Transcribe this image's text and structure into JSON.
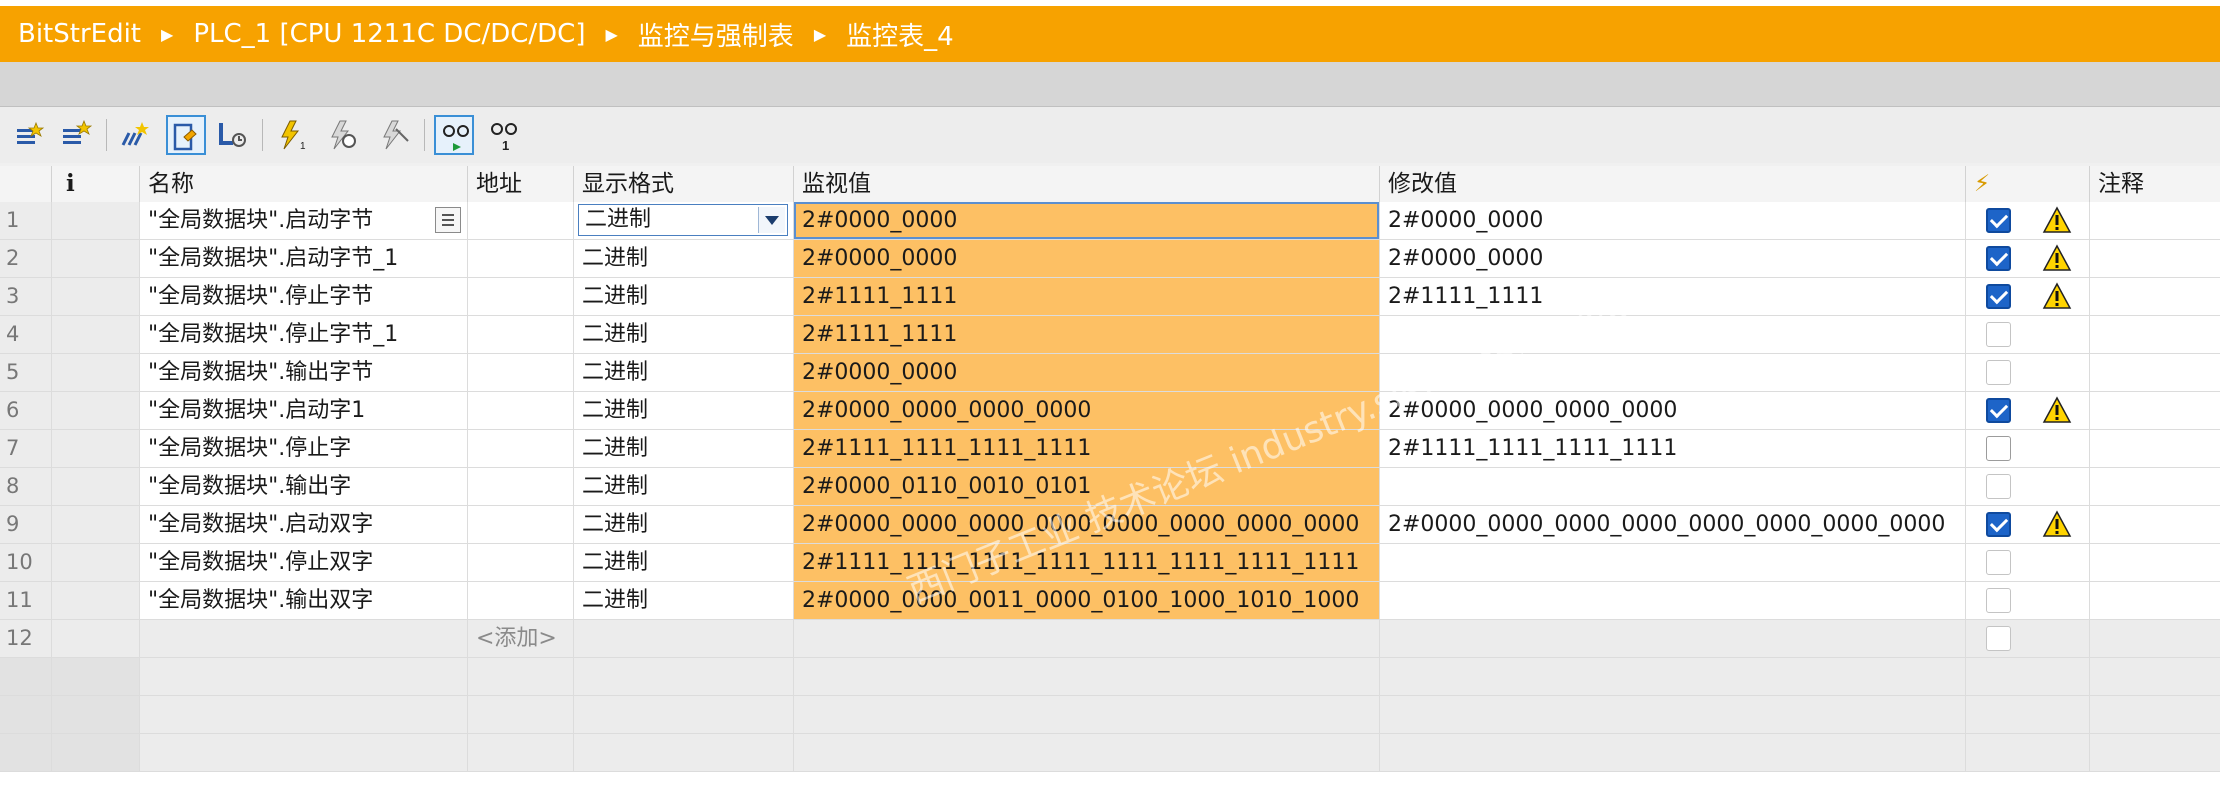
{
  "breadcrumb": {
    "items": [
      "BitStrEdit",
      "PLC_1 [CPU 1211C DC/DC/DC]",
      "监控与强制表",
      "监控表_4"
    ]
  },
  "colors": {
    "title_bar": "#f7a200",
    "value_fill": "#fdc064",
    "checkbox_on": "#1d64c8"
  },
  "toolbar": {
    "icons": [
      "insert-row-icon",
      "add-row-icon",
      "update-snapshot-icon",
      "monitor-all-icon",
      "monitor-now-icon",
      "force-icon",
      "force-now-icon",
      "stop-force-icon",
      "monitor-toggle-icon",
      "monitor-once-icon"
    ]
  },
  "table": {
    "columns": {
      "info": "i",
      "name": "名称",
      "address": "地址",
      "format": "显示格式",
      "monitor": "监视值",
      "modify": "修改值",
      "force": "⚡",
      "comment": "注释"
    },
    "add_label": "<添加>",
    "add_row_num": "12",
    "rows": [
      {
        "num": "1",
        "name": "\"全局数据块\".启动字节",
        "format": "二进制",
        "monitor": "2#0000_0000",
        "modify": "2#0000_0000",
        "checked": true,
        "warn": true
      },
      {
        "num": "2",
        "name": "\"全局数据块\".启动字节_1",
        "format": "二进制",
        "monitor": "2#0000_0000",
        "modify": "2#0000_0000",
        "checked": true,
        "warn": true
      },
      {
        "num": "3",
        "name": "\"全局数据块\".停止字节",
        "format": "二进制",
        "monitor": "2#1111_1111",
        "modify": "2#1111_1111",
        "checked": true,
        "warn": true
      },
      {
        "num": "4",
        "name": "\"全局数据块\".停止字节_1",
        "format": "二进制",
        "monitor": "2#1111_1111",
        "modify": "",
        "checked": false,
        "warn": false
      },
      {
        "num": "5",
        "name": "\"全局数据块\".输出字节",
        "format": "二进制",
        "monitor": "2#0000_0000",
        "modify": "",
        "checked": false,
        "warn": false
      },
      {
        "num": "6",
        "name": "\"全局数据块\".启动字1",
        "format": "二进制",
        "monitor": "2#0000_0000_0000_0000",
        "modify": "2#0000_0000_0000_0000",
        "checked": true,
        "warn": true
      },
      {
        "num": "7",
        "name": "\"全局数据块\".停止字",
        "format": "二进制",
        "monitor": "2#1111_1111_1111_1111",
        "modify": "2#1111_1111_1111_1111",
        "checked": false,
        "warn": false
      },
      {
        "num": "8",
        "name": "\"全局数据块\".输出字",
        "format": "二进制",
        "monitor": "2#0000_0110_0010_0101",
        "modify": "",
        "checked": false,
        "warn": false
      },
      {
        "num": "9",
        "name": "\"全局数据块\".启动双字",
        "format": "二进制",
        "monitor": "2#0000_0000_0000_0000_0000_0000_0000_0000",
        "modify": "2#0000_0000_0000_0000_0000_0000_0000_0000",
        "checked": true,
        "warn": true
      },
      {
        "num": "10",
        "name": "\"全局数据块\".停止双字",
        "format": "二进制",
        "monitor": "2#1111_1111_1111_1111_1111_1111_1111_1111",
        "modify": "",
        "checked": false,
        "warn": false
      },
      {
        "num": "11",
        "name": "\"全局数据块\".输出双字",
        "format": "二进制",
        "monitor": "2#0000_0000_0011_0000_0100_1000_1010_1000",
        "modify": "",
        "checked": false,
        "warn": false
      }
    ]
  },
  "watermark": "西门子工业 技术论坛 industry.siemens.com/cs"
}
